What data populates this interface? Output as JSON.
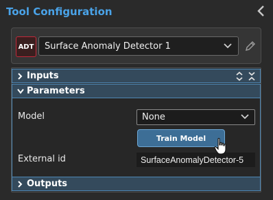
{
  "panel": {
    "title": "Tool Configuration"
  },
  "tool": {
    "badge": "ADT",
    "selected_tool": "Surface Anomaly Detector 1"
  },
  "sections": {
    "inputs_label": "Inputs",
    "parameters_label": "Parameters",
    "outputs_label": "Outputs"
  },
  "parameters": {
    "model_label": "Model",
    "model_value": "None",
    "train_button": "Train Model",
    "external_id_label": "External id",
    "external_id_value": "SurfaceAnomalyDetector-5"
  },
  "icons": {
    "collapse": "chevron-left-icon",
    "edit": "pencil-icon",
    "expand_all": "expand-vertical-icon",
    "collapse_all": "collapse-vertical-icon",
    "cursor": "hand-pointer-icon"
  },
  "colors": {
    "accent": "#4aa3e8",
    "section_bg": "#344a5c",
    "button_bg": "#3d6e96",
    "badge_border": "#c2283a"
  }
}
